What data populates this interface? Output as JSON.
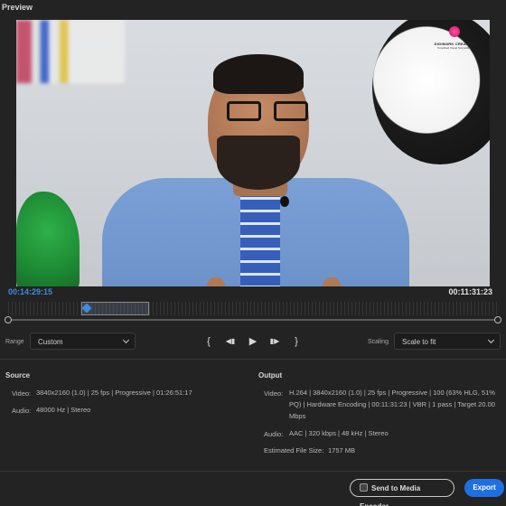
{
  "preview": {
    "title": "Preview"
  },
  "watermark": {
    "name": "DIGIMARK CREATIVE",
    "tagline": "Simplified Visual Storytelling"
  },
  "timecode": {
    "current": "00:14:29:15",
    "duration": "00:11:31:23"
  },
  "controls": {
    "range_label": "Range",
    "range_value": "Custom",
    "scaling_label": "Scaling",
    "scaling_value": "Scale to fit",
    "transport": {
      "set_in": "{",
      "step_back": "◀▮",
      "play": "▶",
      "step_forward": "▮▶",
      "set_out": "}"
    }
  },
  "source": {
    "title": "Source",
    "video_label": "Video:",
    "video_value": "3840x2160 (1.0)  |  25 fps  |  Progressive  |  01:26:51:17",
    "audio_label": "Audio:",
    "audio_value": "48000 Hz  |  Stereo"
  },
  "output": {
    "title": "Output",
    "video_label": "Video:",
    "video_value": "H.264  |  3840x2160 (1.0)  |  25 fps  |  Progressive  |  100 (63% HLG, 51% PQ)  |  Hardware Encoding  |  00:11:31:23  |  VBR  |  1 pass  |  Target 20.00 Mbps",
    "audio_label": "Audio:",
    "audio_value": "AAC  |  320 kbps  |  48 kHz  |  Stereo",
    "size_label": "Estimated File Size:",
    "size_value": "1757 MB"
  },
  "footer": {
    "media_encoder_label": "Send to Media Encoder",
    "export_label": "Export"
  },
  "colors": {
    "accent": "#1f6fe0",
    "timecode": "#3d8de0",
    "background": "#232323"
  }
}
